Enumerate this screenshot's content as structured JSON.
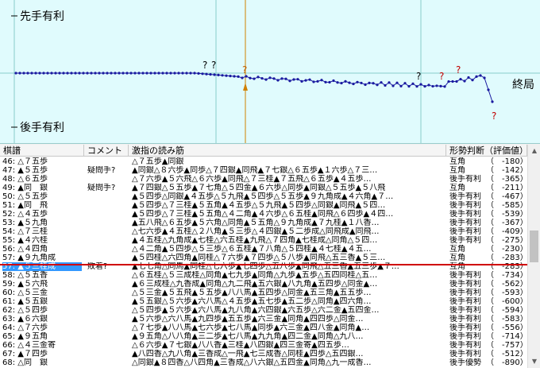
{
  "graph": {
    "top_label": "先手有利",
    "bottom_label": "後手有利",
    "end_label": "終局",
    "question_mark": "?",
    "colors": {
      "background": "#e0fbfd",
      "line": "#1a1aa0",
      "cursor": "#d08000",
      "red": "#d00000",
      "grid": "#88cccc"
    }
  },
  "table": {
    "headers": {
      "kifu": "棋譜",
      "comment": "コメント",
      "pv": "激指の読み筋",
      "judgment": "形勢判断（評価値）"
    },
    "rows": [
      {
        "kifu": "46: △７五歩",
        "comment": "",
        "pv": "△７五歩▲同銀",
        "judgment": "互角",
        "value": "（　-180）"
      },
      {
        "kifu": "47: ▲５五歩",
        "comment": "疑問手?",
        "pv": "▲同銀△８六歩▲同歩△７四銀▲同飛▲７七銀△６五歩▲１六歩△７三…",
        "judgment": "互角",
        "value": "（　-142）"
      },
      {
        "kifu": "48: △６五歩",
        "comment": "",
        "pv": "△７六歩▲５六飛△６六歩▲同飛△７三桂▲７五飛△６五歩▲４五歩…",
        "judgment": "後手有利",
        "value": "（　-365）"
      },
      {
        "kifu": "49: ▲同　銀",
        "comment": "疑問手?",
        "pv": "▲７四銀△５五歩▲７七角△５四金▲６六歩△同歩▲同銀△５五歩▲５八飛",
        "judgment": "互角",
        "value": "（　-211）"
      },
      {
        "kifu": "50: △５五歩",
        "comment": "",
        "pv": "▲５四歩△同銀▲４五歩△５九飛▲５四歩△５五歩▲９九角成▲４六角▲７…",
        "judgment": "後手有利",
        "value": "（　-467）"
      },
      {
        "kifu": "51: ▲同　飛",
        "comment": "",
        "pv": "▲５四歩△７三桂▲５五角▲４五歩△５九飛▲５四歩△同銀▲同飛▲５四…",
        "judgment": "後手有利",
        "value": "（　-585）"
      },
      {
        "kifu": "52: △４五歩",
        "comment": "",
        "pv": "▲５四歩△７三桂▲５五角△４二角▲４六歩△６五桂▲同飛△６四歩▲４四…",
        "judgment": "後手有利",
        "value": "（　-539）"
      },
      {
        "kifu": "53: ▲５九角",
        "comment": "",
        "pv": "▲五八飛△６五歩▲５六角△同角▲５五角△９九角成▲７九桂▲１八香…",
        "judgment": "後手有利",
        "value": "（　-367）"
      },
      {
        "kifu": "54: △７三桂",
        "comment": "",
        "pv": "△七六歩▲４五桂△２八角▲５三歩△４四銀▲５二歩成△同飛成▲同飛…",
        "judgment": "後手有利",
        "value": "（　-409）"
      },
      {
        "kifu": "55: ▲４六桂",
        "comment": "",
        "pv": "▲４五桂△九角成▲七桂△六五桂▲九飛△７四角▲七桂成△同角△５四…",
        "judgment": "後手有利",
        "value": "（　-275）"
      },
      {
        "kifu": "56: △４四角",
        "comment": "",
        "pv": "△４二角▲５四歩△５三歩△６五桂▲７八角△５四桂▲４七桂▲４五…",
        "judgment": "互角",
        "value": "（　-230）"
      },
      {
        "kifu": "57: ▲９九角成",
        "comment": "",
        "pv": "▲５四桂△六四角▲同桂△７六歩▲７四歩△５八歩▲同飛△五三香▲５三…",
        "judgment": "互角",
        "value": "（　-283）"
      },
      {
        "kifu": "57: ▲５三桂成",
        "comment": "敗着?",
        "pv": "▲七七角△同馬▲同桂△七六歩▲七四歩△五八歩▲同飛△五三香▲五三歩▲７…",
        "judgment": "互角",
        "value": "（　-283）",
        "selected": true
      },
      {
        "kifu": "58: △５五香",
        "comment": "",
        "pv": "△６五桂△５三成桂△同角▲七九歩▲同角△九歩▲五歩△五四同桂△五…",
        "judgment": "後手有利",
        "value": "（　-734）"
      },
      {
        "kifu": "59: ▲５六飛",
        "comment": "",
        "pv": "▲６三成桂△九香成▲同角△九二飛▲五六銀▲八九角▲五四歩△同金▲…",
        "judgment": "後手有利",
        "value": "（　-562）"
      },
      {
        "kifu": "60: △５三金",
        "comment": "",
        "pv": "△５三金▲５五飛▲５五歩▲八八馬▲五四歩△同金▲五三角▲五五歩…",
        "judgment": "後手有利",
        "value": "（　-593）"
      },
      {
        "kifu": "61: ▲５五銀",
        "comment": "",
        "pv": "▲５五銀△５六歩▲六八馬△４五歩▲五七歩▲五二歩△同角▲四六角…",
        "judgment": "後手有利",
        "value": "（　-600）"
      },
      {
        "kifu": "62: △５四歩",
        "comment": "",
        "pv": "△５四歩▲５六歩▲六八馬▲九八角▲六四銀▲六五歩△六二金▲五四金…",
        "judgment": "後手有利",
        "value": "（　-594）"
      },
      {
        "kifu": "63: ▲６六銀",
        "comment": "",
        "pv": "▲５六歩△六八馬▲九四歩▲五五歩▲六三金▲同角▲四四歩△同金…",
        "judgment": "後手有利",
        "value": "（　-583）"
      },
      {
        "kifu": "64: △７六歩",
        "comment": "",
        "pv": "△７七歩▲八八馬▲七六歩▲七八馬▲同歩▲六三金▲四八金▲同角▲…",
        "judgment": "後手有利",
        "value": "（　-556）"
      },
      {
        "kifu": "65: ▲９五角",
        "comment": "",
        "pv": "▲９五角△八八角▲三二歩▲七八馬▲九九角▲四二金▲同角△九八…",
        "judgment": "後手有利",
        "value": "（　-714）"
      },
      {
        "kifu": "66: △４三金寄",
        "comment": "",
        "pv": "△６六歩▲７七銀▲八八香▲三桂▲八四銀▲四三金寄▲四五歩…",
        "judgment": "後手有利",
        "value": "（　-757）"
      },
      {
        "kifu": "67: ▲７四歩",
        "comment": "",
        "pv": "▲八四香△九八角▲三香成△一飛▲七三成香△同桂▲四歩△五四銀…",
        "judgment": "後手有利",
        "value": "（　-512）"
      },
      {
        "kifu": "68: △同　銀",
        "comment": "",
        "pv": "△同銀▲８四香△八四角▲三香成△八六銀△五四金▲同角△九一成香…",
        "judgment": "後手優勢",
        "value": "（　-890）"
      }
    ]
  }
}
